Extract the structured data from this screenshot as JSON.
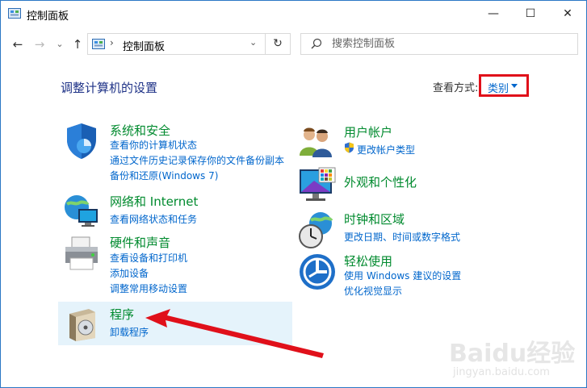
{
  "window": {
    "title": "控制面板",
    "minimize": "—",
    "maximize": "☐",
    "close": "✕"
  },
  "nav": {
    "back": "←",
    "forward": "→",
    "recent": "⌄",
    "up": "↑",
    "refresh": "↻",
    "path_sep": "›",
    "path": "控制面板",
    "dropdown": "⌄"
  },
  "search": {
    "placeholder": "搜索控制面板",
    "value": ""
  },
  "heading": "调整计算机的设置",
  "view": {
    "label": "查看方式:",
    "value": "类别"
  },
  "categories": [
    {
      "title": "系统和安全",
      "links": [
        "查看你的计算机状态",
        "通过文件历史记录保存你的文件备份副本",
        "备份和还原(Windows 7)"
      ],
      "icon": "shield-icon"
    },
    {
      "title": "网络和 Internet",
      "links": [
        "查看网络状态和任务"
      ],
      "icon": "network-globe-icon"
    },
    {
      "title": "硬件和声音",
      "links": [
        "查看设备和打印机",
        "添加设备",
        "调整常用移动设置"
      ],
      "icon": "printer-icon"
    },
    {
      "title": "程序",
      "links": [
        "卸载程序"
      ],
      "icon": "programs-disk-icon"
    },
    {
      "title": "用户帐户",
      "links": [
        "更改帐户类型"
      ],
      "icon": "users-icon"
    },
    {
      "title": "外观和个性化",
      "links": [],
      "icon": "monitor-palette-icon"
    },
    {
      "title": "时钟和区域",
      "links": [
        "更改日期、时间或数字格式"
      ],
      "icon": "clock-globe-icon"
    },
    {
      "title": "轻松使用",
      "links": [
        "使用 Windows 建议的设置",
        "优化视觉显示"
      ],
      "icon": "accessibility-icon"
    }
  ],
  "watermark": {
    "brand": "Baidu经验",
    "url": "jingyan.baidu.com"
  },
  "colors": {
    "heading": "#1e3287",
    "category_title": "#008a2e",
    "link": "#0066cc",
    "highlight": "#e5f3fb",
    "annotation_red": "#e0101a"
  }
}
